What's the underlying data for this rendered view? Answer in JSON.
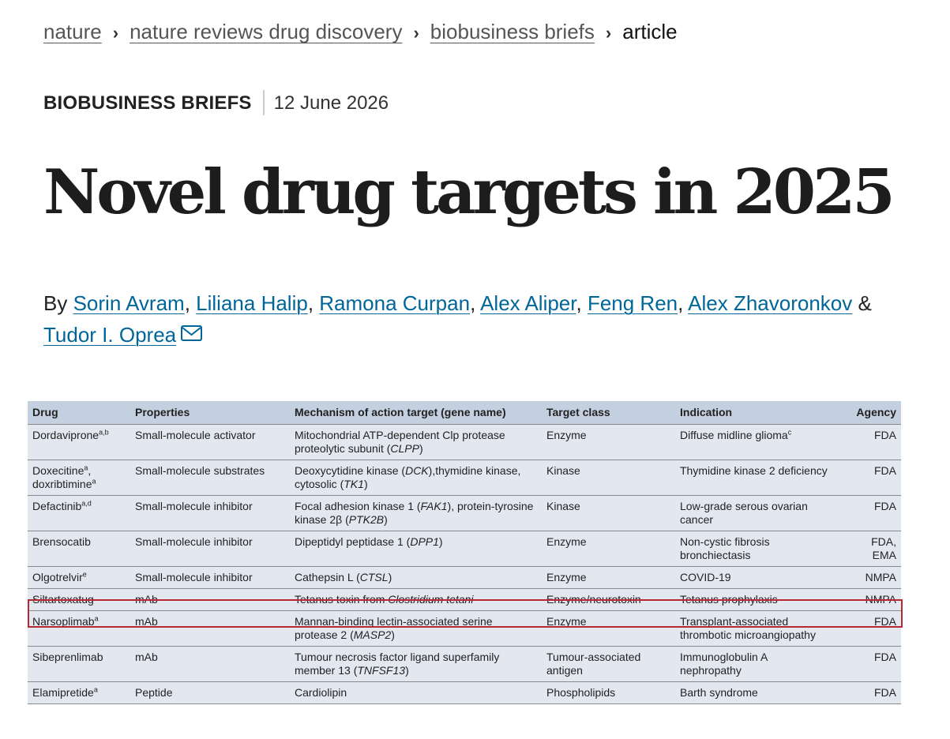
{
  "breadcrumb": {
    "items": [
      "nature",
      "nature reviews drug discovery",
      "biobusiness briefs"
    ],
    "current": "article",
    "separator": "›"
  },
  "meta": {
    "article_type": "BIOBUSINESS BRIEFS",
    "date": "12 June 2026"
  },
  "title": "Novel drug targets in 2025",
  "authors": {
    "prefix": "By",
    "names": [
      "Sorin Avram",
      "Liliana Halip",
      "Ramona Curpan",
      "Alex Aliper",
      "Feng Ren",
      "Alex Zhavoronkov",
      "Tudor I. Oprea"
    ],
    "conjunction": "&",
    "contact_icon": "mail-icon"
  },
  "table": {
    "headers": [
      "Drug",
      "Properties",
      "Mechanism of action target (gene name)",
      "Target class",
      "Indication",
      "Agency"
    ],
    "rows": [
      {
        "drug": "Dordaviprone",
        "drug_sup": "a,b",
        "properties": "Small-molecule activator",
        "mechanism": "Mitochondrial ATP-dependent Clp protease proteolytic subunit (CLPP)",
        "target_class": "Enzyme",
        "indication": "Diffuse midline glioma",
        "indication_sup": "c",
        "agency": "FDA"
      },
      {
        "drug": "Doxecitine",
        "drug_sup": "a",
        "drug2": "doxribtimine",
        "drug2_sup": "a",
        "properties": "Small-molecule substrates",
        "mechanism": "Deoxycytidine kinase (DCK),thymidine kinase, cytosolic (TK1)",
        "target_class": "Kinase",
        "indication": "Thymidine kinase 2 deficiency",
        "agency": "FDA"
      },
      {
        "drug": "Defactinib",
        "drug_sup": "a,d",
        "properties": "Small-molecule inhibitor",
        "mechanism": "Focal adhesion kinase 1 (FAK1), protein-tyrosine kinase 2β (PTK2B)",
        "target_class": "Kinase",
        "indication": "Low-grade serous ovarian cancer",
        "agency": "FDA"
      },
      {
        "drug": "Brensocatib",
        "properties": "Small-molecule inhibitor",
        "mechanism": "Dipeptidyl peptidase 1 (DPP1)",
        "target_class": "Enzyme",
        "indication": "Non-cystic fibrosis bronchiectasis",
        "agency": "FDA, EMA"
      },
      {
        "drug": "Olgotrelvir",
        "drug_sup": "e",
        "properties": "Small-molecule inhibitor",
        "mechanism": "Cathepsin L (CTSL)",
        "target_class": "Enzyme",
        "indication": "COVID-19",
        "agency": "NMPA"
      },
      {
        "drug": "Siltartoxatug",
        "properties": "mAb",
        "mechanism": "Tetanus toxin from Clostridium tetani",
        "target_class": "Enzyme/neurotoxin",
        "indication": "Tetanus prophylaxis",
        "agency": "NMPA",
        "highlighted": true
      },
      {
        "drug": "Narsoplimab",
        "drug_sup": "a",
        "properties": "mAb",
        "mechanism": "Mannan-binding lectin-associated serine protease 2 (MASP2)",
        "target_class": "Enzyme",
        "indication": "Transplant-associated thrombotic microangiopathy",
        "agency": "FDA"
      },
      {
        "drug": "Sibeprenlimab",
        "properties": "mAb",
        "mechanism": "Tumour necrosis factor ligand superfamily member 13 (TNFSF13)",
        "target_class": "Tumour-associated antigen",
        "indication": "Immunoglobulin A nephropathy",
        "agency": "FDA"
      },
      {
        "drug": "Elamipretide",
        "drug_sup": "a",
        "properties": "Peptide",
        "mechanism": "Cardiolipin",
        "target_class": "Phospholipids",
        "indication": "Barth syndrome",
        "agency": "FDA"
      }
    ]
  },
  "colors": {
    "link": "#006699",
    "breadcrumb_link": "#555555",
    "table_header_bg": "#c4cfdf",
    "table_row_bg": "#e3e8f0",
    "highlight_border": "#b52a32"
  }
}
